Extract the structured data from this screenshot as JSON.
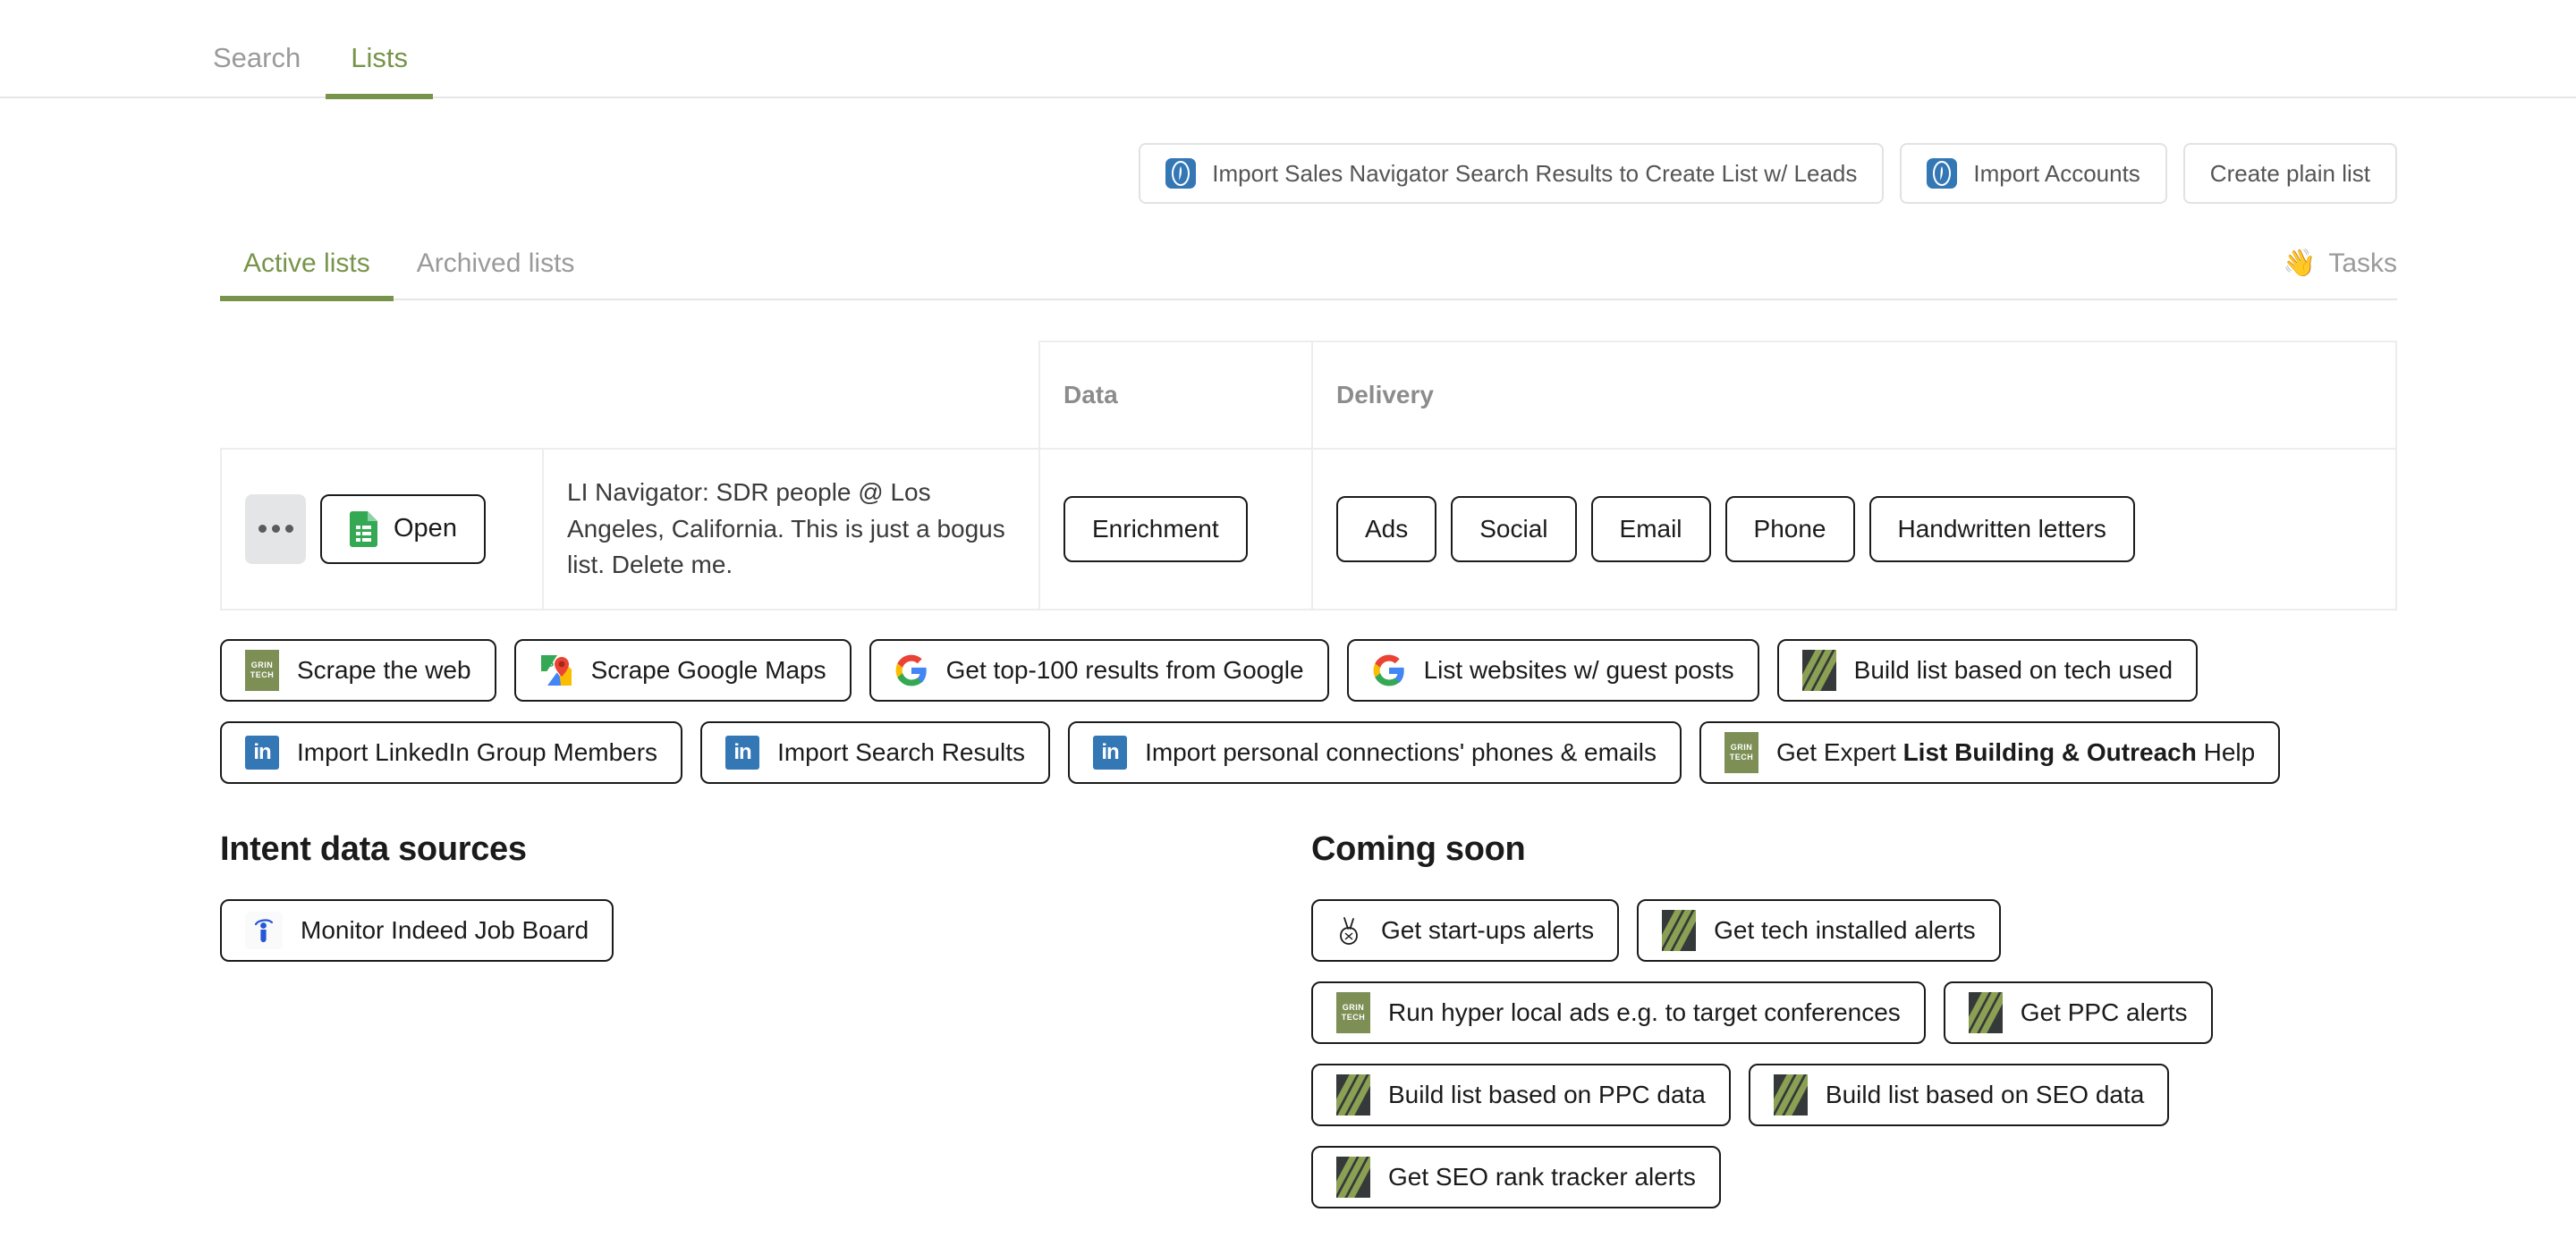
{
  "topnav": {
    "tabs": [
      {
        "label": "Search",
        "active": false
      },
      {
        "label": "Lists",
        "active": true
      }
    ]
  },
  "import_row": {
    "buttons": [
      {
        "label": "Import Sales Navigator Search Results to Create List w/ Leads",
        "icon": "sales-navigator-icon"
      },
      {
        "label": "Import Accounts",
        "icon": "sales-navigator-icon"
      },
      {
        "label": "Create plain list",
        "icon": "none"
      }
    ]
  },
  "subtabs": {
    "tabs": [
      {
        "label": "Active lists",
        "active": true
      },
      {
        "label": "Archived lists",
        "active": false
      }
    ],
    "tasks": {
      "emoji": "👋",
      "label": "Tasks"
    }
  },
  "table": {
    "headers": [
      "",
      "",
      "Data",
      "Delivery"
    ],
    "rows": [
      {
        "menu_label": "",
        "open_label": "Open",
        "name": "LI Navigator: SDR people @ Los Angeles, California. This is just a bogus list. Delete me.",
        "data": [
          "Enrichment"
        ],
        "delivery": [
          "Ads",
          "Social",
          "Email",
          "Phone",
          "Handwritten letters"
        ]
      }
    ]
  },
  "actions": {
    "row1": [
      {
        "label": "Scrape the web",
        "icon": "grintech-icon"
      },
      {
        "label": "Scrape Google Maps",
        "icon": "google-maps-icon"
      },
      {
        "label": "Get top-100 results from Google",
        "icon": "google-icon"
      },
      {
        "label": "List websites w/ guest posts",
        "icon": "google-icon"
      },
      {
        "label": "Build list based on tech used",
        "icon": "tech-icon"
      }
    ],
    "row2": [
      {
        "label": "Import LinkedIn Group Members",
        "icon": "linkedin-icon"
      },
      {
        "label": "Import Search Results",
        "icon": "linkedin-icon"
      },
      {
        "label": "Import personal connections' phones & emails",
        "icon": "linkedin-icon"
      },
      {
        "label_html": "Get Expert <b>List Building &amp; Outreach</b> Help",
        "icon": "grintech-icon"
      }
    ]
  },
  "intent": {
    "title": "Intent data sources",
    "items": [
      {
        "label": "Monitor Indeed Job Board",
        "icon": "indeed-icon"
      }
    ]
  },
  "coming_soon": {
    "title": "Coming soon",
    "rows": [
      [
        {
          "label": "Get start-ups alerts",
          "icon": "angellist-icon"
        },
        {
          "label": "Get tech installed alerts",
          "icon": "tech-icon"
        }
      ],
      [
        {
          "label": "Run hyper local ads e.g. to target conferences",
          "icon": "grintech-icon"
        },
        {
          "label": "Get PPC alerts",
          "icon": "tech-icon"
        }
      ],
      [
        {
          "label": "Build list based on PPC data",
          "icon": "tech-icon"
        },
        {
          "label": "Build list based on SEO data",
          "icon": "tech-icon"
        }
      ],
      [
        {
          "label": "Get SEO rank tracker alerts",
          "icon": "tech-icon"
        }
      ]
    ]
  },
  "colors": {
    "accent_green": "#77944a",
    "grintech_green": "#7d8f55",
    "linkedin_blue": "#3477b5",
    "tech_dark": "#35393a",
    "indeed_blue": "#2557d6",
    "sheets_green": "#34a853",
    "muted_text": "#9a9a9a"
  },
  "grintech_icon_text": {
    "line1": "GRIN",
    "line2": "TECH"
  }
}
